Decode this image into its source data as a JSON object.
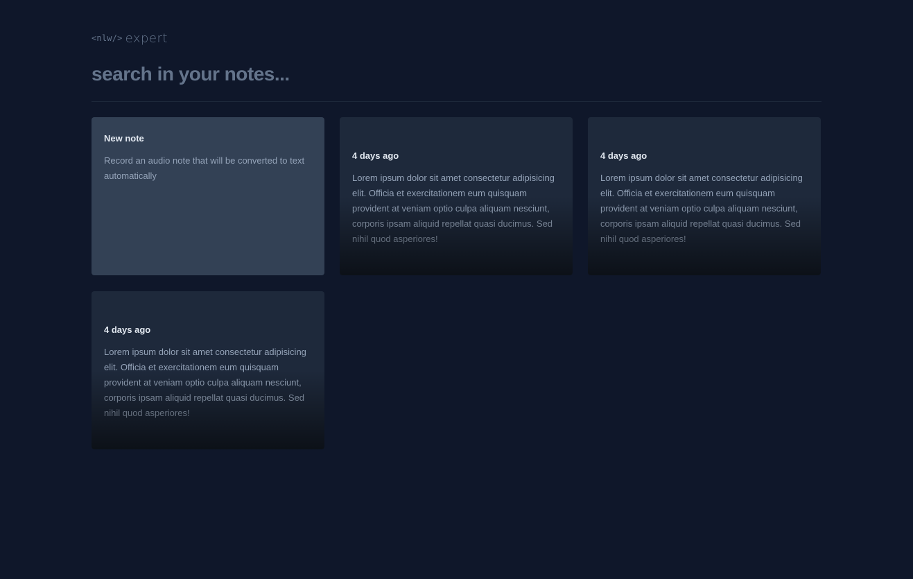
{
  "logo": {
    "code": "<nlw/>",
    "word": "expert"
  },
  "search": {
    "placeholder": "search in your notes..."
  },
  "new_note": {
    "title": "New note",
    "description": "Record an audio note that will be converted to text automatically"
  },
  "notes": [
    {
      "date": "4 days ago",
      "content": "Lorem ipsum dolor sit amet consectetur adipisicing elit. Officia et exercitationem eum quisquam provident at veniam optio culpa aliquam nesciunt, corporis ipsam aliquid repellat quasi ducimus. Sed nihil quod asperiores!"
    },
    {
      "date": "4 days ago",
      "content": "Lorem ipsum dolor sit amet consectetur adipisicing elit. Officia et exercitationem eum quisquam provident at veniam optio culpa aliquam nesciunt, corporis ipsam aliquid repellat quasi ducimus. Sed nihil quod asperiores!"
    },
    {
      "date": "4 days ago",
      "content": "Lorem ipsum dolor sit amet consectetur adipisicing elit. Officia et exercitationem eum quisquam provident at veniam optio culpa aliquam nesciunt, corporis ipsam aliquid repellat quasi ducimus. Sed nihil quod asperiores!"
    }
  ],
  "colors": {
    "background": "#0f172a",
    "card_new": "#334155",
    "card_note": "#1e293b",
    "text_muted": "#94a3b8",
    "text_strong": "#e2e8f0",
    "placeholder": "#64748b"
  }
}
